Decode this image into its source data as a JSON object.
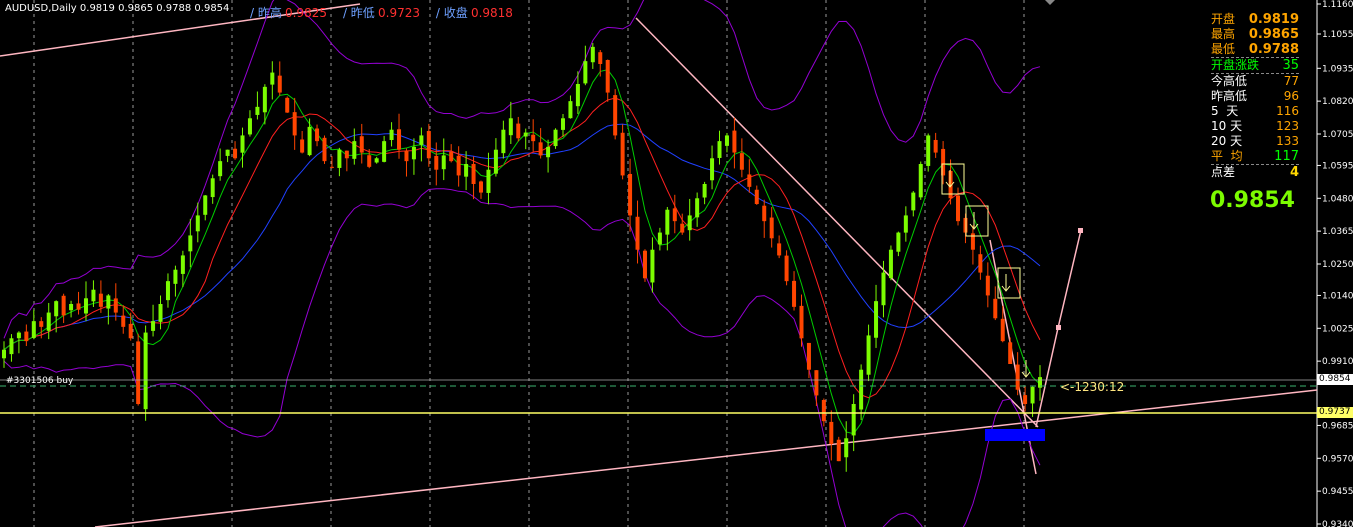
{
  "header": {
    "symbol": "AUDUSD,Daily",
    "ohlc": "0.9819 0.9865 0.9788 0.9854",
    "prev_high_label": "/ 昨高",
    "prev_high_value": "0.9825",
    "prev_low_label": "/ 昨低",
    "prev_low_value": "0.9723",
    "prev_close_label": "/ 收盘",
    "prev_close_value": "0.9818"
  },
  "panel": {
    "open_label": "开盘",
    "open_value": "0.9819",
    "high_label": "最高",
    "high_value": "0.9865",
    "low_label": "最低",
    "low_value": "0.9788",
    "gap_label": "开盘涨跌",
    "gap_value": "35",
    "today_range_label": "今高低",
    "today_range_value": "77",
    "yesterday_range_label": "昨高低",
    "yesterday_range_value": "96",
    "d5_label": "5  天",
    "d5_value": "116",
    "d10_label": "10 天",
    "d10_value": "123",
    "d20_label": "20 天",
    "d20_value": "133",
    "avg_label": "平  均",
    "avg_value": "117",
    "spread_label": "点差",
    "spread_value": "4",
    "current_price": "0.9854"
  },
  "order_label": "#3301506 buy",
  "countdown": "<-1230:12",
  "current_price_box": "0.9854",
  "support_price_box": "0.9737",
  "colors": {
    "bull": "#7cfc00",
    "bear": "#ff4500",
    "support": "#ffff66",
    "trendline": "#ffb6c1",
    "bollinger": "#9400d3",
    "ma_fast": "#00cc00",
    "ma_mid": "#ff2020",
    "ma_slow": "#2040ff",
    "target_zone": "#0000ff"
  },
  "chart_data": {
    "type": "candlestick",
    "symbol": "AUDUSD",
    "timeframe": "Daily",
    "y_ticks": [
      "1.1160",
      "1.1055",
      "1.0935",
      "1.0820",
      "1.0705",
      "1.0595",
      "1.0480",
      "1.0365",
      "1.0250",
      "1.0140",
      "1.0025",
      "0.9910",
      "0.9685",
      "0.9570",
      "0.9455",
      "0.9340"
    ],
    "ylim": [
      0.934,
      1.116
    ],
    "support_level": 0.9737,
    "current_price": 0.9854,
    "close_path": [
      0.995,
      0.999,
      1.001,
      0.998,
      1.005,
      1.003,
      1.008,
      1.012,
      1.007,
      1.011,
      1.009,
      1.013,
      1.016,
      1.01,
      1.014,
      1.008,
      1.003,
      0.999,
      0.976,
      1.001,
      1.005,
      1.011,
      1.019,
      1.023,
      1.028,
      1.035,
      1.042,
      1.049,
      1.055,
      1.061,
      1.065,
      1.062,
      1.07,
      1.076,
      1.08,
      1.087,
      1.092,
      1.085,
      1.078,
      1.07,
      1.064,
      1.073,
      1.068,
      1.061,
      1.059,
      1.065,
      1.062,
      1.068,
      1.064,
      1.059,
      1.062,
      1.068,
      1.072,
      1.065,
      1.061,
      1.066,
      1.07,
      1.062,
      1.058,
      1.063,
      1.061,
      1.056,
      1.06,
      1.053,
      1.05,
      1.058,
      1.065,
      1.072,
      1.076,
      1.069,
      1.071,
      1.068,
      1.063,
      1.066,
      1.072,
      1.076,
      1.082,
      1.088,
      1.096,
      1.101,
      1.095,
      1.085,
      1.07,
      1.056,
      1.042,
      1.03,
      1.02,
      1.03,
      1.036,
      1.044,
      1.04,
      1.036,
      1.042,
      1.048,
      1.053,
      1.062,
      1.068,
      1.07,
      1.064,
      1.058,
      1.052,
      1.046,
      1.04,
      1.034,
      1.028,
      1.019,
      1.01,
      0.999,
      0.988,
      0.979,
      0.97,
      0.962,
      0.956,
      0.964,
      0.976,
      0.988,
      1.0,
      1.012,
      1.022,
      1.03,
      1.036,
      1.042,
      1.05,
      1.06,
      1.07,
      1.064,
      1.056,
      1.048,
      1.04,
      1.036,
      1.03,
      1.022,
      1.014,
      1.006,
      0.998,
      0.99,
      0.981,
      0.976,
      0.982,
      0.9854
    ]
  }
}
